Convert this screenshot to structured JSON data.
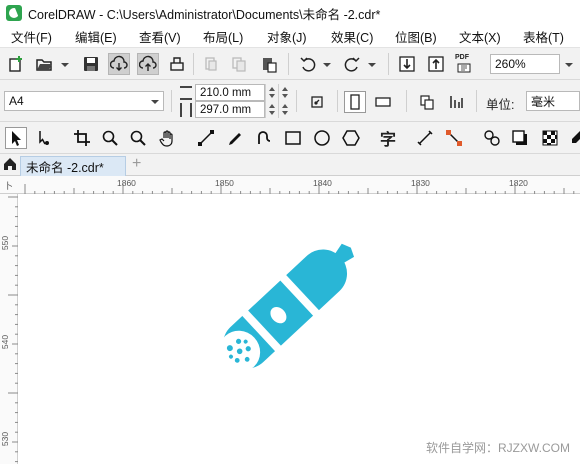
{
  "window": {
    "title": "CorelDRAW - C:\\Users\\Administrator\\Documents\\未命名 -2.cdr*"
  },
  "menu": [
    "文件(F)",
    "编辑(E)",
    "查看(V)",
    "布局(L)",
    "对象(J)",
    "效果(C)",
    "位图(B)",
    "文本(X)",
    "表格(T)"
  ],
  "toolbar": {
    "zoom_value": "260%",
    "pdf_label": "PDF"
  },
  "property_bar": {
    "page_size": "A4",
    "width": "210.0 mm",
    "height": "297.0 mm",
    "units_label": "单位:",
    "units_value": "毫米"
  },
  "toolbox": {
    "text_tool_glyph": "字"
  },
  "document_tab": {
    "label": "未命名 -2.cdr*",
    "add_label": "+"
  },
  "ruler": {
    "horizontal_ticks": [
      "1860",
      "1850",
      "1840",
      "1830",
      "1820"
    ],
    "vertical_ticks": [
      "550",
      "540",
      "530"
    ],
    "corner_label": "卜"
  },
  "artwork": {
    "name": "sausage-illustration",
    "color": "#29b6d6"
  },
  "watermark": "软件自学网：RJZXW.COM",
  "colors": {
    "accent": "#29b6d6",
    "toolbar_bg": "#f2f2f2",
    "tab_bg": "#dbe8f5"
  }
}
